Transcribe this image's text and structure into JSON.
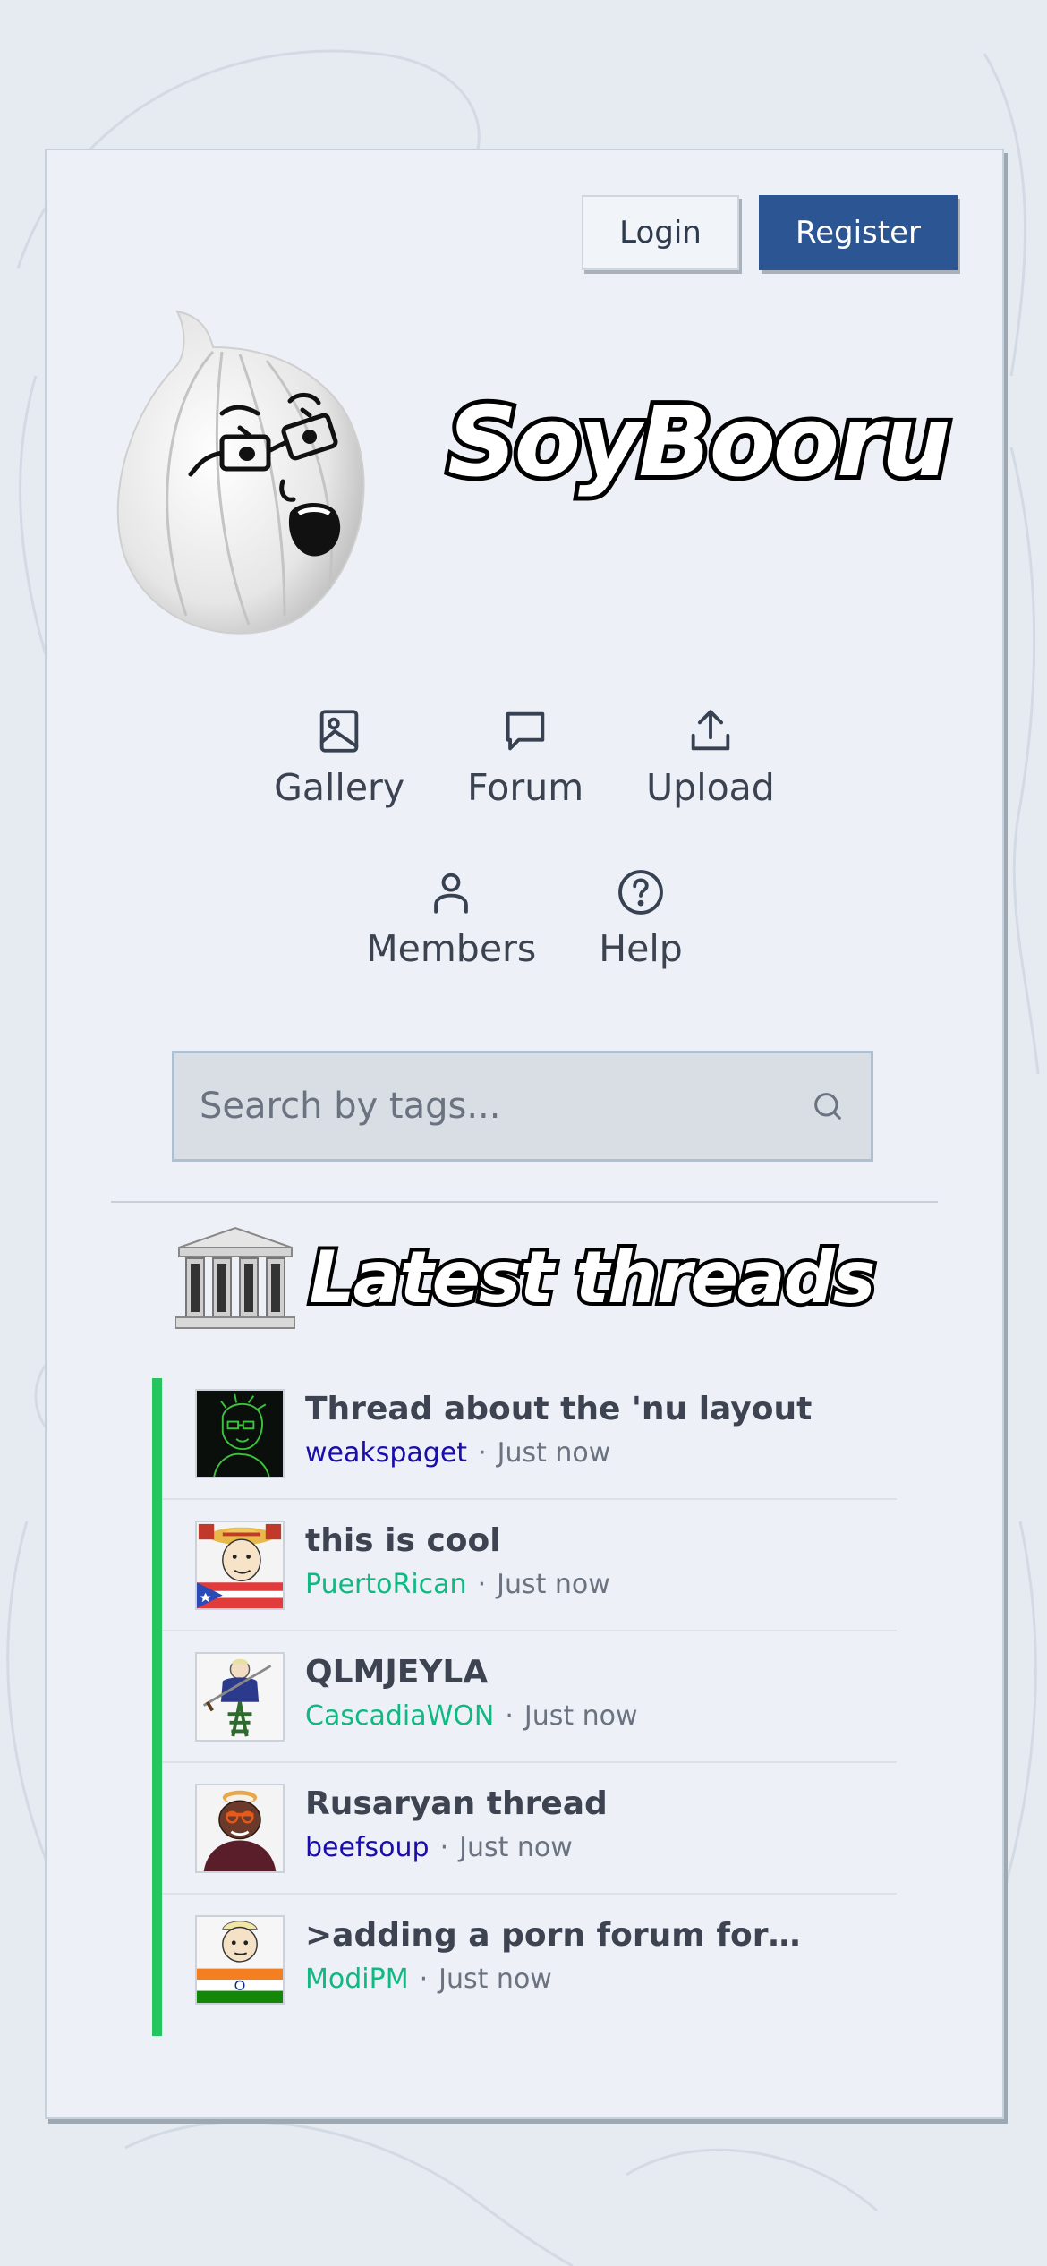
{
  "header": {
    "login_label": "Login",
    "register_label": "Register",
    "brand_color": "#2c5693"
  },
  "logo": {
    "text": "SoyBooru"
  },
  "nav": {
    "items": [
      {
        "label": "Gallery",
        "icon": "image-icon"
      },
      {
        "label": "Forum",
        "icon": "chat-bubble-icon"
      },
      {
        "label": "Upload",
        "icon": "upload-icon"
      },
      {
        "label": "Members",
        "icon": "user-icon"
      },
      {
        "label": "Help",
        "icon": "help-circle-icon"
      }
    ]
  },
  "search": {
    "placeholder": "Search by tags...",
    "value": ""
  },
  "threads": {
    "title": "Latest threads",
    "accent_color": "#22c55e",
    "items": [
      {
        "title": "Thread about the 'nu layout",
        "author": "weakspaget",
        "time": "Just now",
        "author_color": "#1a0dab"
      },
      {
        "title": "this is cool",
        "author": "PuertoRican",
        "time": "Just now",
        "author_color": "#10b981"
      },
      {
        "title": "QLMJEYLA",
        "author": "CascadiaWON",
        "time": "Just now",
        "author_color": "#10b981"
      },
      {
        "title": "Rusaryan thread",
        "author": "beefsoup",
        "time": "Just now",
        "author_color": "#1a0dab"
      },
      {
        "title": ">adding a porn forum for…",
        "author": "ModiPM",
        "time": "Just now",
        "author_color": "#10b981"
      }
    ],
    "separator": "·"
  }
}
